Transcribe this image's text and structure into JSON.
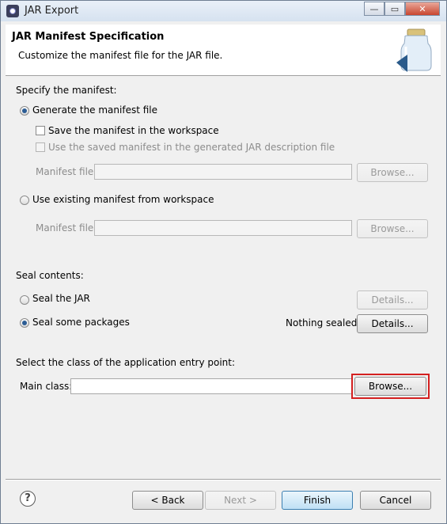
{
  "window": {
    "title": "JAR Export",
    "minimize": "—",
    "maximize": "▭",
    "close": "✕"
  },
  "header": {
    "title": "JAR Manifest Specification",
    "description": "Customize the manifest file for the JAR file."
  },
  "manifest": {
    "section_label": "Specify the manifest:",
    "generate_label": "Generate the manifest file",
    "save_label": "Save the manifest in the workspace",
    "use_saved_label": "Use the saved manifest in the generated JAR description file",
    "manifest_file_label": "Manifest file:",
    "manifest_file_value": "",
    "browse_label": "Browse...",
    "use_existing_label": "Use existing manifest from workspace",
    "existing_file_label": "Manifest file:",
    "existing_file_value": "",
    "existing_browse_label": "Browse..."
  },
  "seal": {
    "section_label": "Seal contents:",
    "seal_jar_label": "Seal the JAR",
    "seal_jar_details": "Details...",
    "seal_some_label": "Seal some packages",
    "status": "Nothing sealed",
    "seal_some_details": "Details..."
  },
  "entry": {
    "section_label": "Select the class of the application entry point:",
    "main_class_label": "Main class:",
    "main_class_value": "",
    "browse_label": "Browse..."
  },
  "footer": {
    "help": "?",
    "back": "< Back",
    "next": "Next >",
    "finish": "Finish",
    "cancel": "Cancel"
  }
}
